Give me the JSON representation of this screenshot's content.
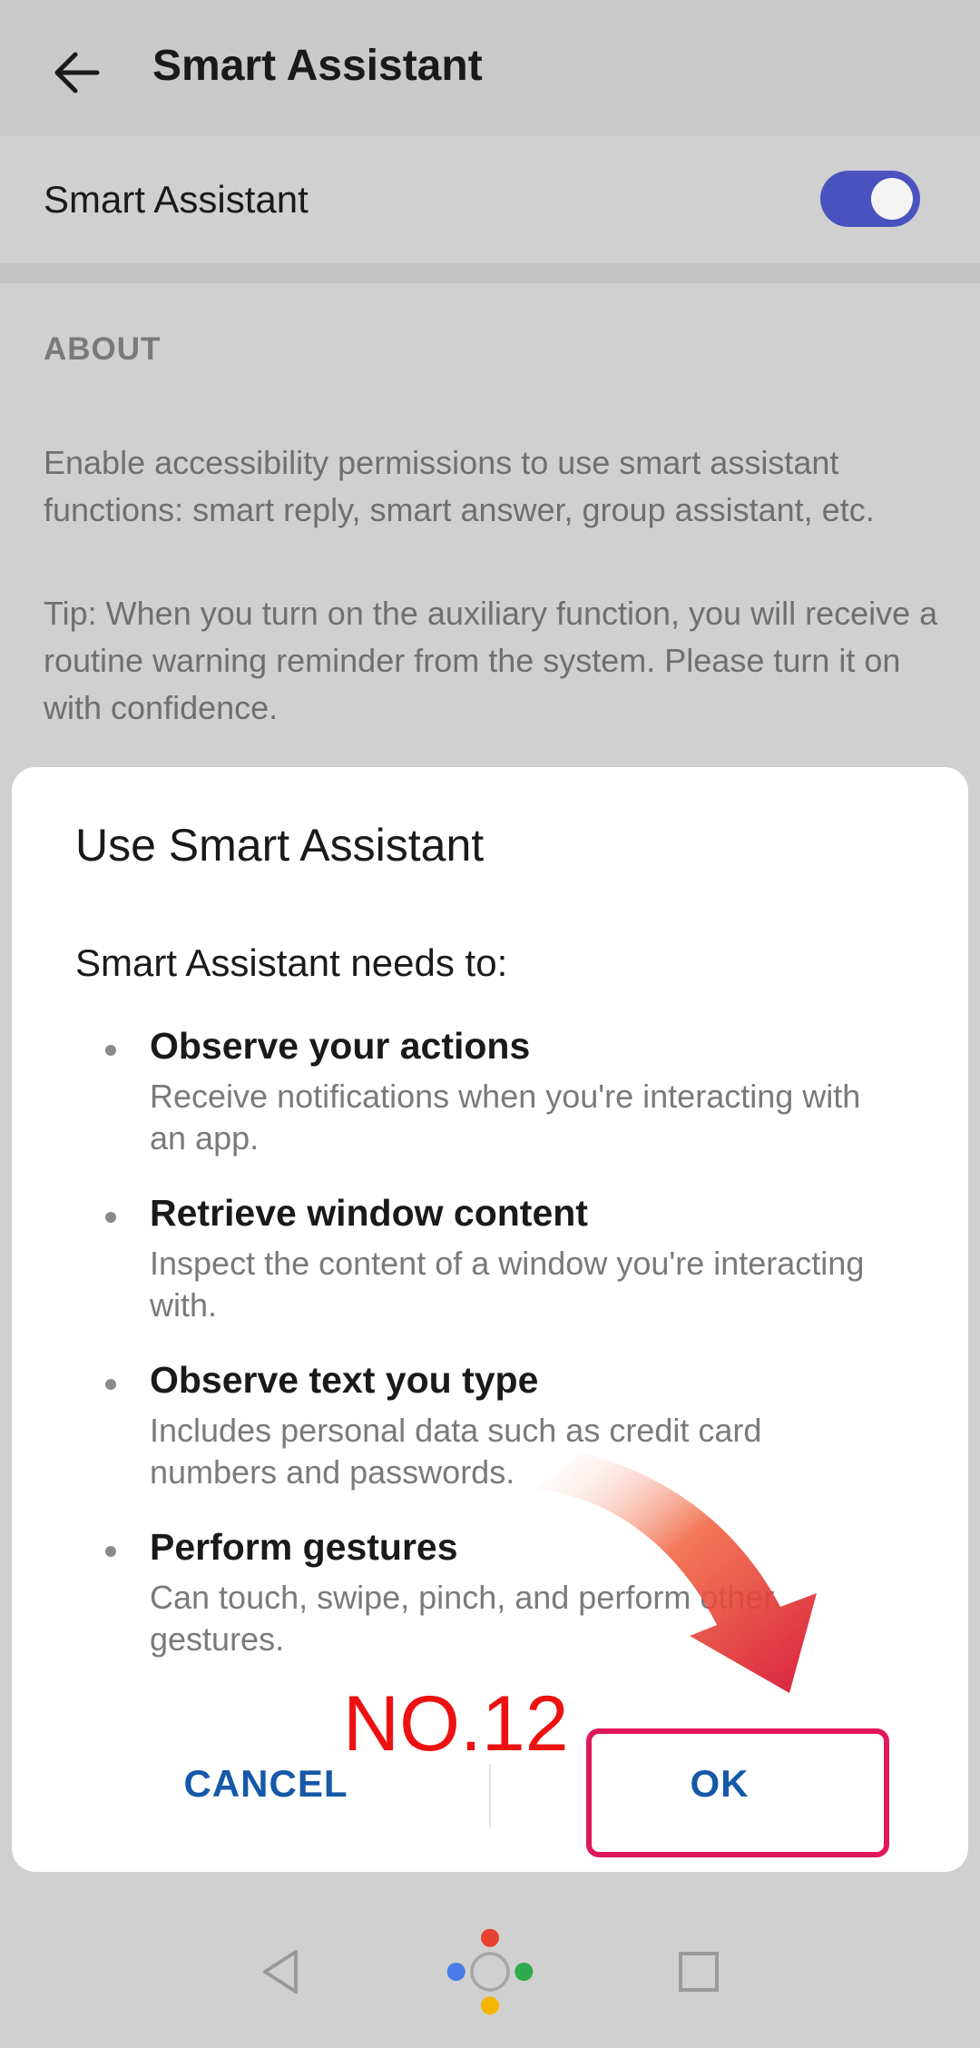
{
  "toolbar": {
    "title": "Smart Assistant",
    "back_icon": "arrow-left-icon"
  },
  "setting": {
    "label": "Smart Assistant",
    "toggle_state": "on",
    "accent_color": "#4a52c0"
  },
  "about": {
    "header": "ABOUT",
    "body": "Enable accessibility permissions to use smart assistant functions: smart reply, smart answer, group assistant, etc.",
    "tip": "Tip: When you turn on the auxiliary function, you will receive a routine warning reminder from the system. Please turn it on with confidence."
  },
  "dialog": {
    "title": "Use Smart Assistant",
    "intro": "Smart Assistant needs to:",
    "permissions": [
      {
        "title": "Observe your actions",
        "desc": "Receive notifications when you're interacting with an app."
      },
      {
        "title": "Retrieve window content",
        "desc": "Inspect the content of a window you're interacting with."
      },
      {
        "title": "Observe text you type",
        "desc": "Includes personal data such as credit card numbers and passwords."
      },
      {
        "title": "Perform gestures",
        "desc": "Can touch, swipe, pinch, and perform other gestures."
      }
    ],
    "cancel_label": "CANCEL",
    "ok_label": "OK",
    "button_color": "#1558a8"
  },
  "annotation": {
    "label": "NO.12",
    "color": "#ee1111",
    "highlight_color": "#e0185a"
  },
  "navbar": {
    "icons": [
      "back-triangle-icon",
      "home-assistant-icon",
      "recents-square-icon"
    ]
  }
}
